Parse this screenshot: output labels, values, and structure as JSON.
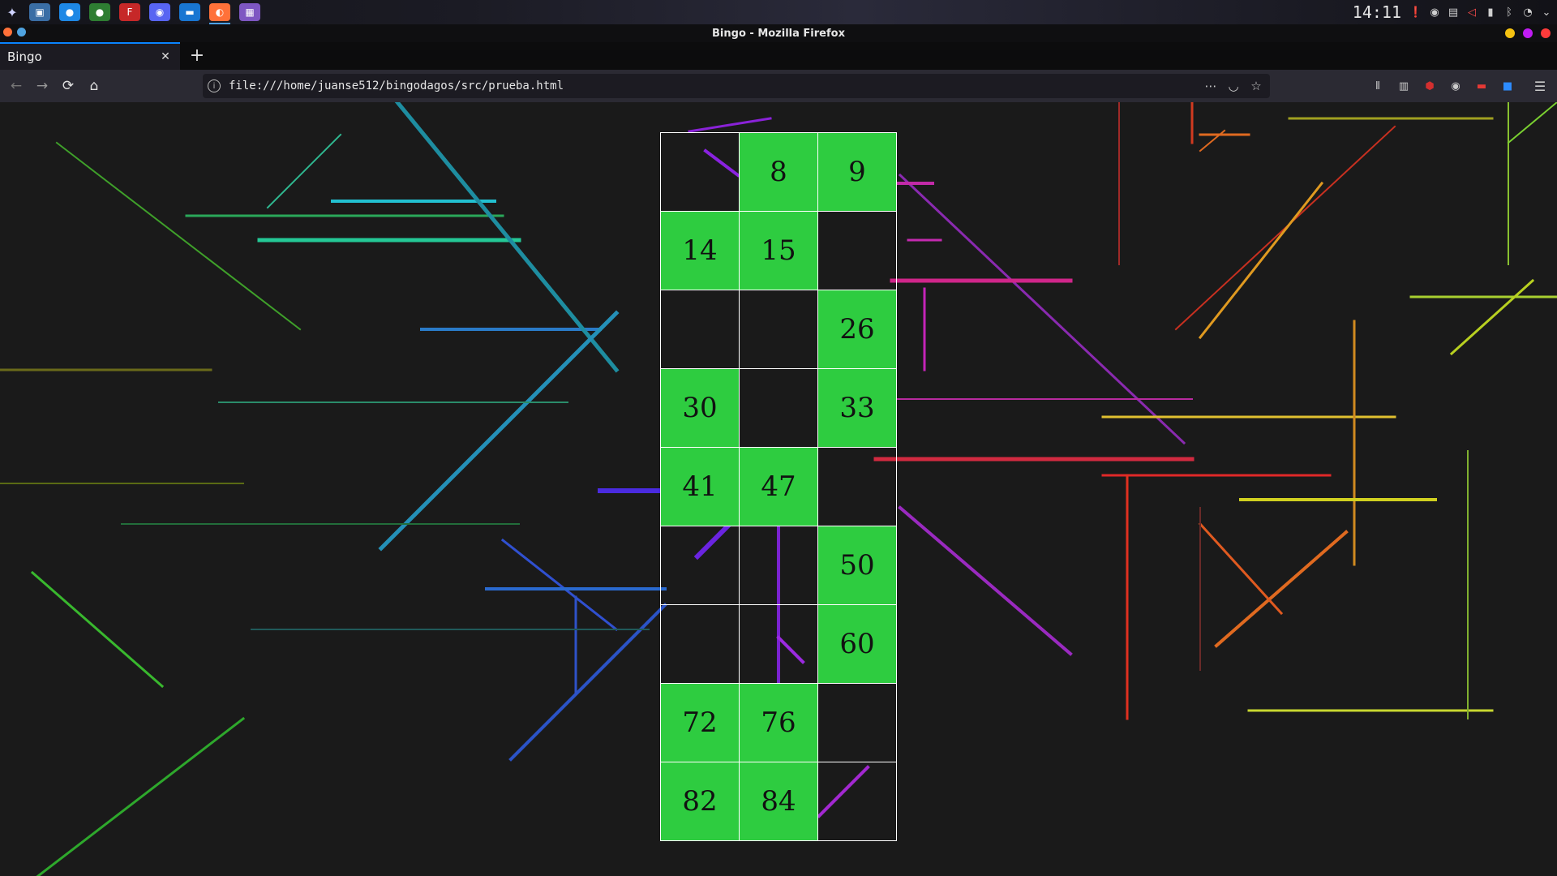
{
  "taskbar": {
    "clock": "14:11",
    "apps": [
      {
        "name": "app-launcher-icon",
        "glyph": "▣",
        "color": "#3a6ea5"
      },
      {
        "name": "krita-icon",
        "glyph": "●",
        "color": "#1e88e5"
      },
      {
        "name": "android-studio-icon",
        "glyph": "●",
        "color": "#2e7d32"
      },
      {
        "name": "filezilla-icon",
        "glyph": "F",
        "color": "#c62828"
      },
      {
        "name": "discord-icon",
        "glyph": "◉",
        "color": "#5865f2"
      },
      {
        "name": "file-manager-icon",
        "glyph": "▬",
        "color": "#1976d2"
      },
      {
        "name": "firefox-icon",
        "glyph": "◐",
        "color": "#ff7139"
      },
      {
        "name": "screenshot-tool-icon",
        "glyph": "▦",
        "color": "#7e57c2"
      }
    ]
  },
  "window": {
    "title": "Bingo - Mozilla Firefox",
    "button_colors": [
      "#f5c211",
      "#c01cf2",
      "#ff3b3b"
    ]
  },
  "browser": {
    "tab_title": "Bingo",
    "url": "file:///home/juanse512/bingodagos/src/prueba.html"
  },
  "bingo": {
    "marked_color": "#2ecc40",
    "rows": [
      [
        "",
        "8",
        "9"
      ],
      [
        "14",
        "15",
        ""
      ],
      [
        "",
        "",
        "26"
      ],
      [
        "30",
        "",
        "33"
      ],
      [
        "41",
        "47",
        ""
      ],
      [
        "",
        "",
        "50"
      ],
      [
        "",
        "",
        "60"
      ],
      [
        "72",
        "76",
        ""
      ],
      [
        "82",
        "84",
        ""
      ]
    ]
  }
}
